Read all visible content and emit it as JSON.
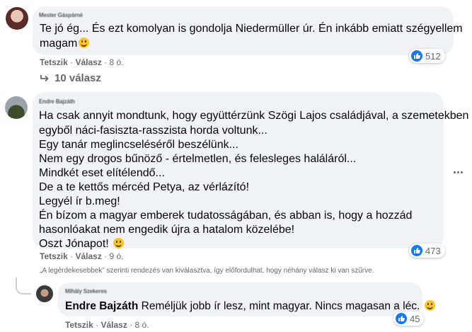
{
  "comments": [
    {
      "author": "Mester Gáspárné",
      "lines": [
        "Te jó ég... És ezt komolyan is gondolja Niedermüller úr. Én inkább emiatt szégyellem",
        "magam"
      ],
      "like_label": "Tetszik",
      "reply_label": "Válasz",
      "time": "8 ó.",
      "reactions": "512",
      "replies_link": "10 válasz"
    },
    {
      "author": "Endre Bajzáth",
      "lines": [
        "Ha csak annyit mondtunk, hogy együttérzünk Szögi Lajos családjával, a szemetekben",
        "egyből náci-fasiszta-rasszista horda voltunk...",
        "Egy tanár meglincseléséről beszélünk...",
        "Nem egy drogos bűnöző - értelmetlen, és felesleges haláláról...",
        "Mindkét eset elítélendő...",
        "De a te kettős mércéd Petya, az vérlázító!",
        "Legyél ír b.meg!",
        "Én bízom a magyar emberek tudatosságában, és abban is, hogy a hozzád",
        "hasonlóakat nem engedik újra a hatalom közelébe!",
        "Oszt Jónapot!"
      ],
      "like_label": "Tetszik",
      "reply_label": "Válasz",
      "time": "9 ó.",
      "reactions": "473"
    }
  ],
  "filter_notice": "„A legérdekesebbek” szerinti rendezés van kiválasztva, így előfordulhat, hogy néhány válasz ki van szűrve.",
  "reply": {
    "author": "Mihály Szekeres",
    "mention": "Endre Bajzáth",
    "text": "Reméljük jobb ír lesz, mint magyar. Nincs magasan a léc.",
    "like_label": "Tetszik",
    "reply_label": "Válasz",
    "time": "8 ó.",
    "reactions": "45"
  },
  "colors": {
    "like_blue": "#1877f2",
    "bubble": "#f0f2f5",
    "meta": "#65676b"
  },
  "icons": {
    "more": "more-horizontal-icon",
    "reply_arrow": "reply-arrow-icon",
    "like": "like-icon",
    "emoji": "smiley-emoji-icon"
  }
}
